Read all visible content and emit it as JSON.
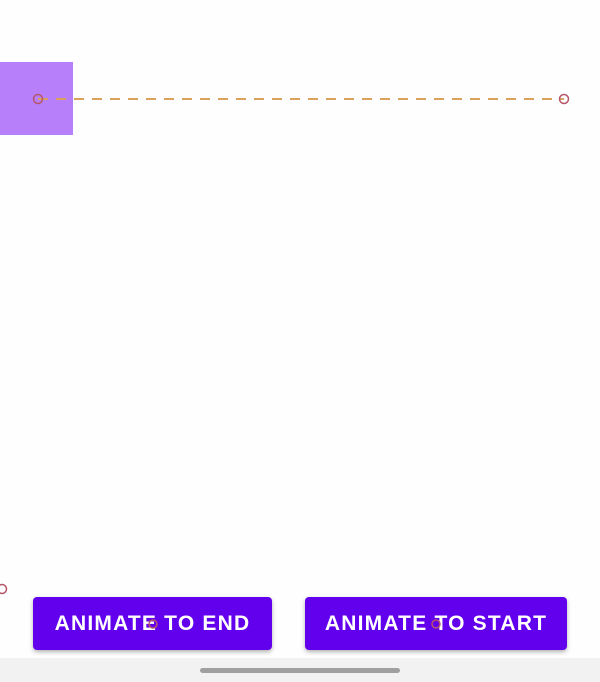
{
  "animated_box": {
    "color": "#b77ffa"
  },
  "motion_path": {
    "color": "#d9a15b",
    "marker_color": "#b5566b"
  },
  "buttons": {
    "animate_to_end": "ANIMATE TO END",
    "animate_to_start": "ANIMATE TO START",
    "color": "#6200ee"
  }
}
